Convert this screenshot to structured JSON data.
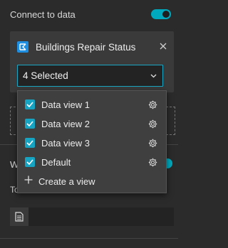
{
  "connect": {
    "label": "Connect to data",
    "enabled": true
  },
  "datasource": {
    "title": "Buildings Repair Status",
    "close_icon": "close-icon",
    "select_value": "4 Selected"
  },
  "background": {
    "section_label_partial": "W",
    "to_label_partial": "To"
  },
  "menu": {
    "items": [
      {
        "label": "Data view 1",
        "checked": true
      },
      {
        "label": "Data view 2",
        "checked": true
      },
      {
        "label": "Data view 3",
        "checked": true
      },
      {
        "label": "Default",
        "checked": true
      }
    ],
    "create_label": "Create a view"
  },
  "colors": {
    "accent": "#00a9bd",
    "checkbox": "#17a3c2",
    "datasource_icon": "#1f8ee0",
    "background": "#2b2b2b",
    "panel": "#3a3a3a",
    "menu": "#3f3f3f"
  }
}
